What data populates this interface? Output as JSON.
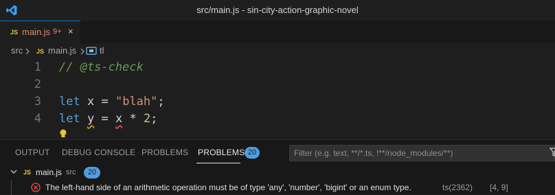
{
  "window": {
    "title": "src/main.js - sin-city-action-graphic-novel"
  },
  "tab": {
    "js_badge": "JS",
    "name": "main.js",
    "count": "9+",
    "close": "×"
  },
  "breadcrumb": {
    "folder": "src",
    "js_badge": "JS",
    "file": "main.js",
    "symbol": "tl"
  },
  "editor": {
    "lines": [
      {
        "num": "1",
        "comment": "// @ts-check"
      },
      {
        "num": "2"
      },
      {
        "num": "3",
        "kw": "let",
        "name": "x",
        "eq": "=",
        "value": "\"blah\"",
        "end": ";"
      },
      {
        "num": "4",
        "kw": "let",
        "name": "y",
        "eq": "=",
        "operand": "x",
        "op": "*",
        "value": "2",
        "end": ";"
      }
    ]
  },
  "panel": {
    "tabs": [
      "OUTPUT",
      "DEBUG CONSOLE",
      "PROBLEMS",
      "PROBLEMS"
    ],
    "problem_count": "20",
    "filter_placeholder": "Filter (e.g. text, **/*.ts, !**/node_modules/**)",
    "group": {
      "js_badge": "JS",
      "file": "main.js",
      "dir": "src",
      "count": "20"
    },
    "problem": {
      "message": "The left-hand side of an arithmetic operation must be of type 'any', 'number', 'bigint' or an enum type.",
      "code": "ts(2362)",
      "position": "[4, 9]"
    }
  },
  "colors": {
    "accent": "#0078d4",
    "badge": "#4e9ee1",
    "error": "#f14c4c",
    "warning_bulb": "#cca700"
  }
}
